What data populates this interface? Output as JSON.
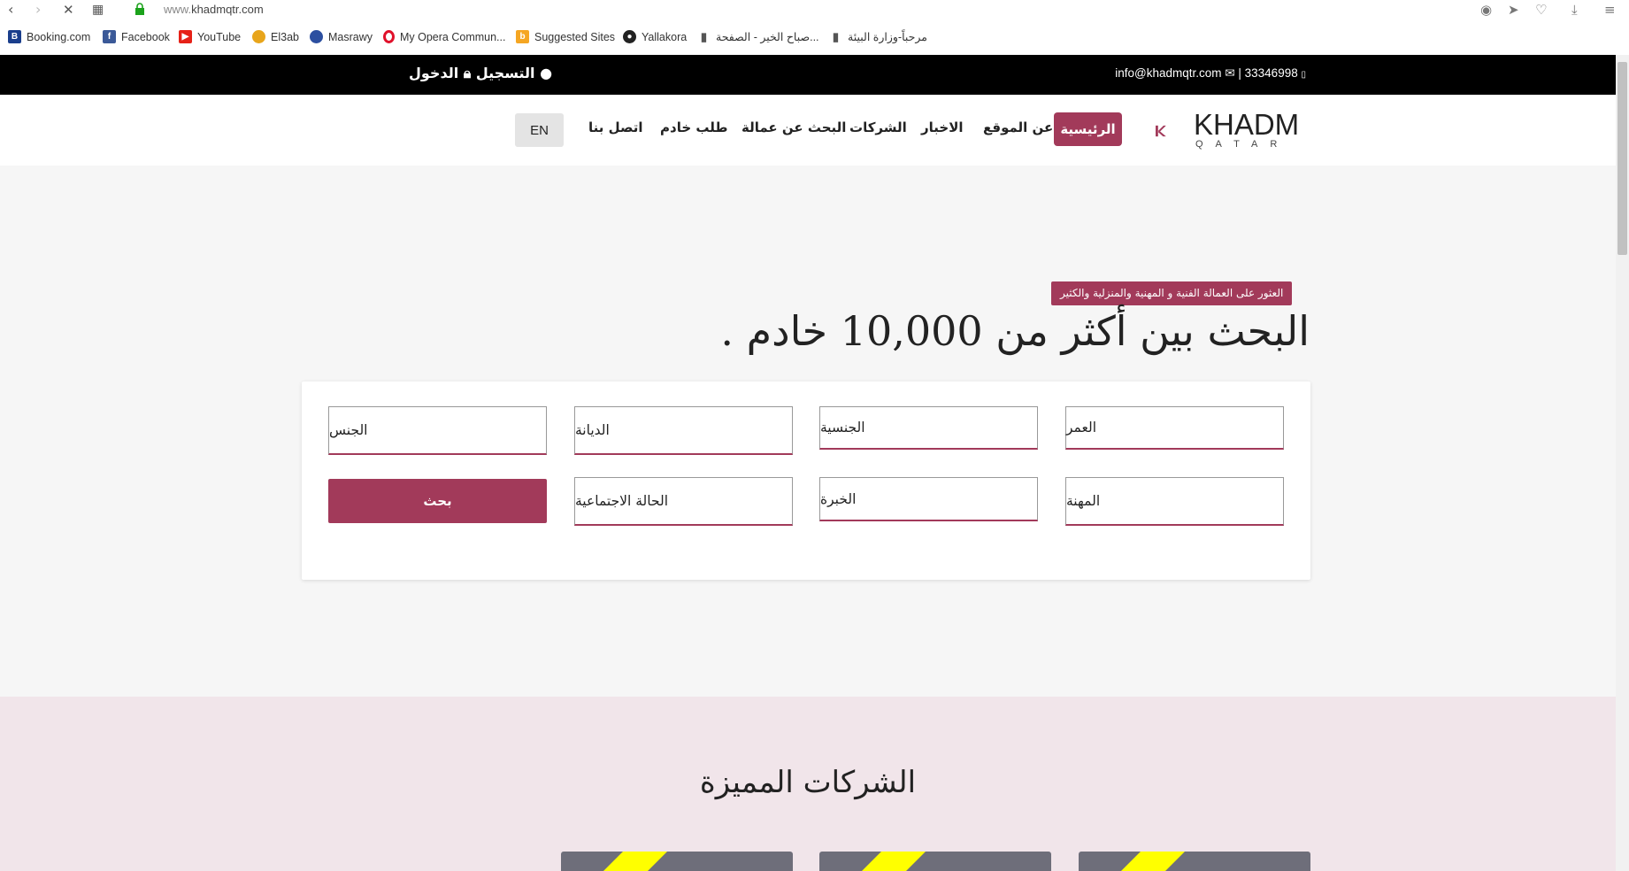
{
  "browser": {
    "url_prefix": "www.",
    "url_domain": "khadmqtr.com",
    "bookmarks": [
      {
        "label": "Booking.com",
        "icon": "booking-icon"
      },
      {
        "label": "Facebook",
        "icon": "facebook-icon"
      },
      {
        "label": "YouTube",
        "icon": "youtube-icon"
      },
      {
        "label": "El3ab",
        "icon": "el3ab-icon"
      },
      {
        "label": "Masrawy",
        "icon": "masrawy-icon"
      },
      {
        "label": "My Opera Commun...",
        "icon": "opera-icon"
      },
      {
        "label": "Suggested Sites",
        "icon": "bing-icon"
      },
      {
        "label": "Yallakora",
        "icon": "ball-icon"
      },
      {
        "label": "صباح الخير - الصفحة...",
        "icon": "page-icon"
      },
      {
        "label": "مرحباً-وزارة البيئة",
        "icon": "page-icon"
      }
    ]
  },
  "topbar": {
    "phone": "| 33346998",
    "email": "info@khadmqtr.com",
    "register": "التسجيل",
    "login": "الدخول"
  },
  "logo": {
    "main": "KHADM",
    "sub": "QATAR"
  },
  "nav": {
    "home": "الرئيسية",
    "about": "عن الموقع",
    "news": "الاخبار",
    "companies": "الشركات",
    "find_workers": "البحث عن عمالة",
    "request_servant": "طلب خادم",
    "contact": "اتصل بنا",
    "lang": "EN"
  },
  "hero": {
    "tagline": "العثور على العمالة الفنية و المهنية والمنزلية والكثير",
    "headline": "البحث بين أكثر من 10,000 خادم ."
  },
  "search": {
    "age": "العمر",
    "nationality": "الجنسية",
    "religion": "الديانة",
    "gender": "الجنس",
    "profession": "المهنة",
    "experience": "الخبرة",
    "marital_status": "الحالة الاجتماعية",
    "button": "بحث"
  },
  "featured": {
    "title": "الشركات المميزة"
  },
  "colors": {
    "accent": "#a23a5a",
    "topbar": "#000000",
    "featured_bg": "#f1e5ea"
  }
}
